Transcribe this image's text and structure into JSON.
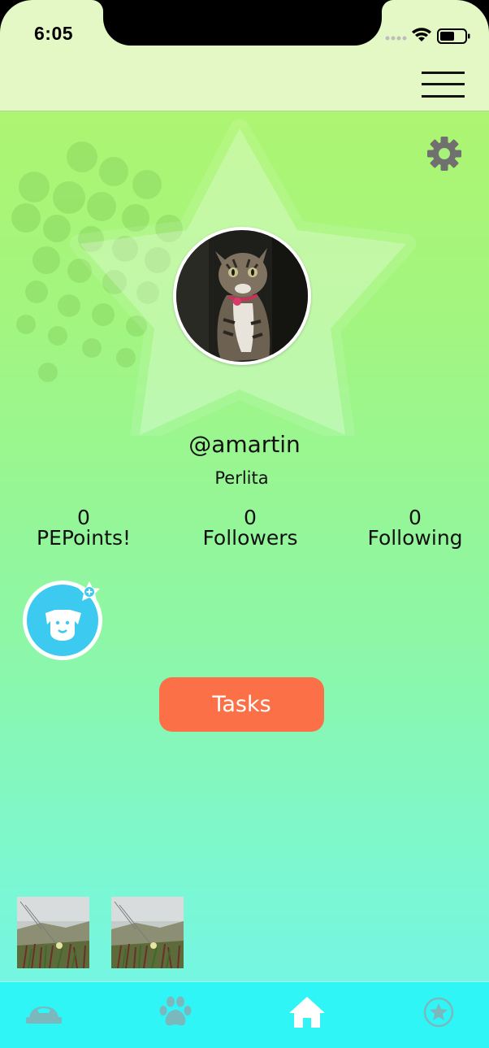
{
  "status_bar": {
    "time": "6:05"
  },
  "profile": {
    "username": "@amartin",
    "pet_name": "Perlita"
  },
  "stats": [
    {
      "value": "0",
      "label": "PEPoints!"
    },
    {
      "value": "0",
      "label": "Followers"
    },
    {
      "value": "0",
      "label": "Following"
    }
  ],
  "actions": {
    "tasks_label": "Tasks"
  },
  "icons": {
    "menu": "hamburger-menu-icon",
    "settings": "gear-icon",
    "add_pet": "dog-face-plus-icon",
    "tabs": [
      "pet-bowl-icon",
      "paw-icon",
      "home-icon",
      "star-icon"
    ]
  },
  "colors": {
    "header_bg": "#e4f8c6",
    "tasks_button": "#fb7046",
    "tab_bar": "#30f5f6",
    "active_tab_icon": "#ffffff",
    "inactive_tab_icon": "#7bb8bd"
  },
  "tabs": {
    "active_index": 2
  }
}
